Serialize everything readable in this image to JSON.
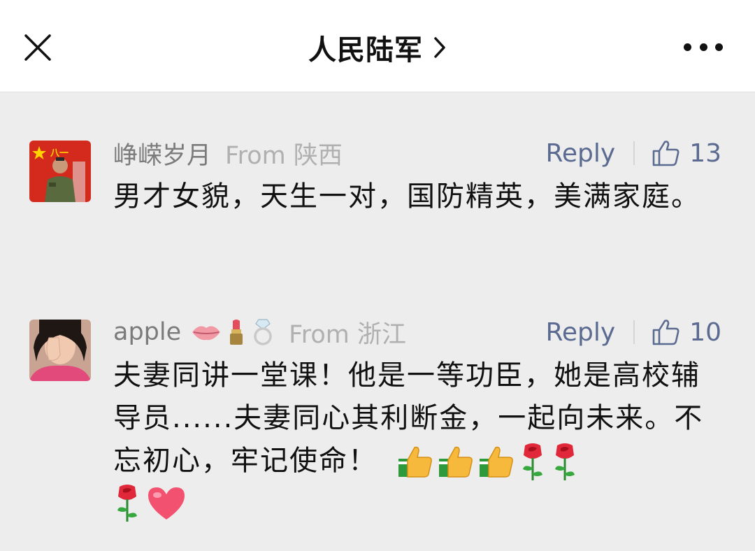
{
  "header": {
    "title": "人民陆军"
  },
  "comments": [
    {
      "nickname": "峥嵘岁月",
      "location": "From 陕西",
      "reply_label": "Reply",
      "likes": "13",
      "text": "男才女貌，天生一对，国防精英，美满家庭。",
      "avatar_text": "八一"
    },
    {
      "nickname": "apple",
      "nickname_badges": [
        "lips-emoji",
        "lipstick-emoji",
        "ring-emoji"
      ],
      "location": "From 浙江",
      "reply_label": "Reply",
      "likes": "10",
      "text": "夫妻同讲一堂课！他是一等功臣，她是高校辅导员......夫妻同心其利断金，一起向未来。不忘初心，牢记使命！",
      "text_emojis": [
        "thumbs-up-emoji",
        "thumbs-up-emoji",
        "thumbs-up-emoji",
        "rose-emoji",
        "rose-emoji",
        "rose-emoji",
        "red-heart-emoji"
      ]
    }
  ],
  "colors": {
    "background": "#ededed",
    "header_bg": "#ffffff",
    "link": "#5b6a90",
    "nickname": "#7b7b7b",
    "location": "#b0b0b0"
  }
}
